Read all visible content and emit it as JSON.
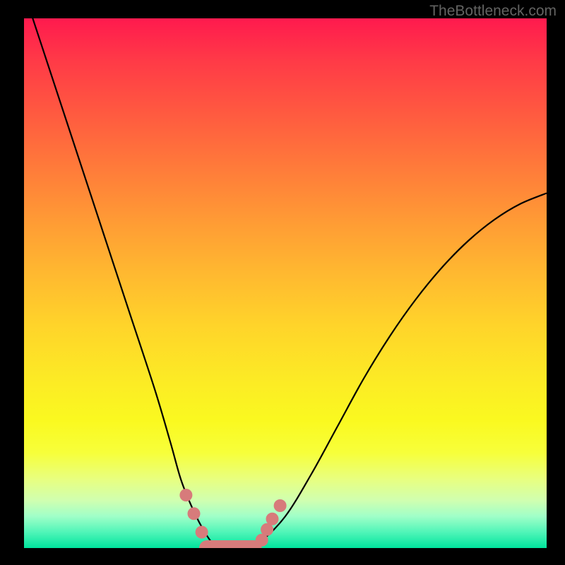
{
  "watermark": "TheBottleneck.com",
  "chart_data": {
    "type": "line",
    "title": "",
    "xlabel": "",
    "ylabel": "",
    "xlim": [
      0,
      100
    ],
    "ylim": [
      0,
      100
    ],
    "grid": false,
    "series": [
      {
        "name": "bottleneck-curve",
        "x": [
          0,
          5,
          10,
          15,
          20,
          25,
          28,
          30,
          32,
          34,
          36,
          38,
          40,
          42,
          45,
          50,
          55,
          60,
          65,
          70,
          75,
          80,
          85,
          90,
          95,
          100
        ],
        "y": [
          105,
          90,
          75,
          60,
          45,
          30,
          20,
          13,
          8,
          4,
          1,
          0,
          0,
          0,
          1,
          6,
          14,
          23,
          32,
          40,
          47,
          53,
          58,
          62,
          65,
          67
        ]
      }
    ],
    "markers": {
      "name": "highlighted-points",
      "color": "#d77b7b",
      "points": [
        {
          "x": 31,
          "y": 10
        },
        {
          "x": 32.5,
          "y": 6.5
        },
        {
          "x": 34,
          "y": 3
        },
        {
          "x": 45.5,
          "y": 1.5
        },
        {
          "x": 46.5,
          "y": 3.5
        },
        {
          "x": 47.5,
          "y": 5.5
        },
        {
          "x": 49,
          "y": 8
        }
      ],
      "plateau": {
        "x1": 35,
        "x2": 44,
        "y": 0
      }
    }
  }
}
